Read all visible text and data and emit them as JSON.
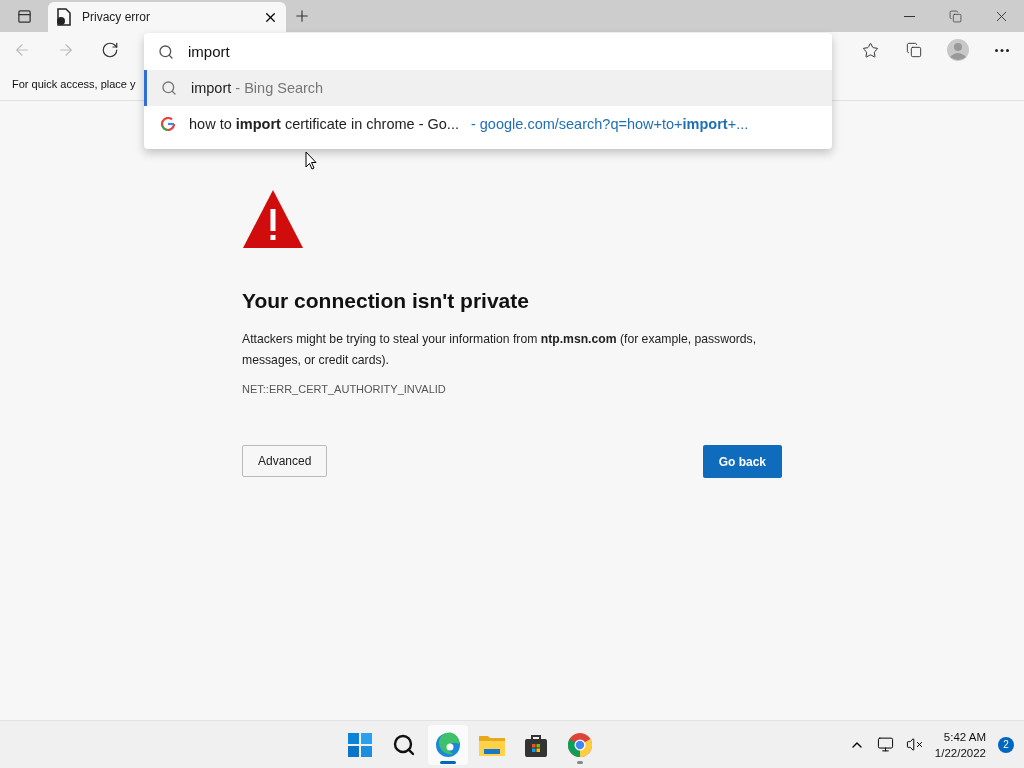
{
  "tabs": [
    {
      "title": "Privacy error",
      "selected": true
    }
  ],
  "address_dropdown": {
    "query": "import",
    "suggestions": [
      {
        "kind": "search",
        "text": "import",
        "suffix": " - Bing Search",
        "selected": true
      },
      {
        "kind": "google",
        "text": "how to **import** certificate in chrome - Go...",
        "url": "- google.com/search?q=how+to+**import**+...",
        "selected": false
      }
    ]
  },
  "favorites_bar": {
    "text": "For quick access, place y"
  },
  "error": {
    "title": "Your connection isn't private",
    "description": "Attackers might be trying to steal your information from **ntp.msn.com** (for example, passwords, messages, or credit cards).",
    "code": "NET::ERR_CERT_AUTHORITY_INVALID",
    "advanced_button": "Advanced",
    "back_button": "Go back"
  },
  "taskbar": {
    "apps": [
      {
        "kind": "start",
        "active": false,
        "running": false
      },
      {
        "kind": "search",
        "active": false,
        "running": false
      },
      {
        "kind": "edge",
        "active": true,
        "running": true
      },
      {
        "kind": "files",
        "active": false,
        "running": false
      },
      {
        "kind": "store",
        "active": false,
        "running": false
      },
      {
        "kind": "chrome",
        "active": false,
        "running": true
      }
    ],
    "time": "5:42 AM",
    "date": "1/22/2022",
    "notifications": "2"
  }
}
